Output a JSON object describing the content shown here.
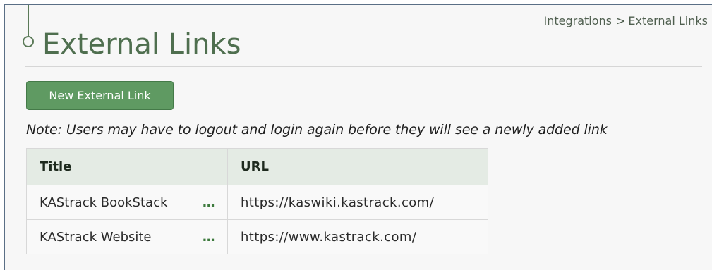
{
  "header": {
    "title": "External Links",
    "breadcrumb": {
      "parent": "Integrations",
      "separator": ">",
      "current": "External Links"
    }
  },
  "toolbar": {
    "new_link_label": "New External Link"
  },
  "note": "Note: Users may have to logout and login again before they will see a newly added link",
  "table": {
    "columns": [
      "Title",
      "URL"
    ],
    "rows": [
      {
        "title": "KAStrack BookStack",
        "more_icon": "...",
        "url": "https://kaswiki.kastrack.com/"
      },
      {
        "title": "KAStrack Website",
        "more_icon": "...",
        "url": "https://www.kastrack.com/"
      }
    ]
  },
  "colors": {
    "accent": "#5f9a62",
    "title": "#4f6f4f",
    "header_bg": "#e4ebe4"
  },
  "icons": {
    "timeline": "timeline-marker-icon",
    "row_menu": "more-options-icon"
  }
}
